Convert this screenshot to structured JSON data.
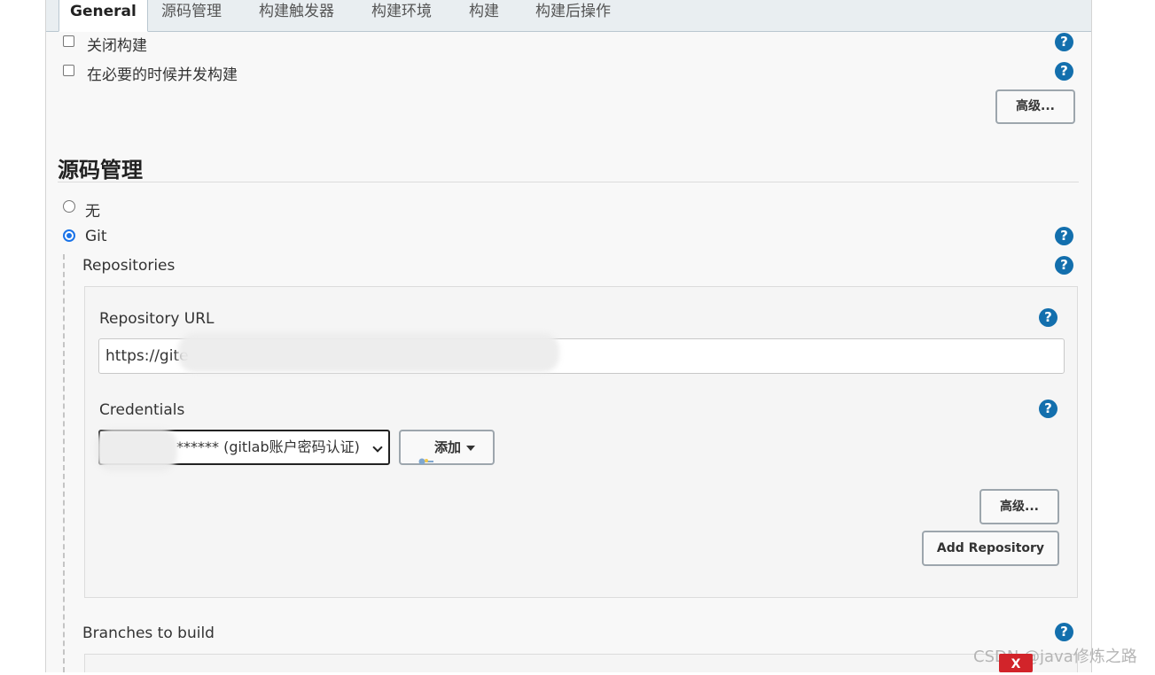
{
  "tabs": [
    "General",
    "源码管理",
    "构建触发器",
    "构建环境",
    "构建",
    "构建后操作"
  ],
  "general": {
    "disable_build": "关闭构建",
    "concurrent_build": "在必要的时候并发构建",
    "advanced": "高级..."
  },
  "scm": {
    "title": "源码管理",
    "option_none": "无",
    "option_git": "Git",
    "selected": "Git"
  },
  "git": {
    "repositories_label": "Repositories",
    "repo_url_label": "Repository URL",
    "repo_url_value": "https://gite",
    "credentials_label": "Credentials",
    "credentials_selected": "****** (gitlab账户密码认证)",
    "add_label": "添加",
    "advanced": "高级...",
    "add_repository": "Add Repository",
    "branches_label": "Branches to build"
  },
  "help_glyph": "?",
  "watermark": "CSDN @java修炼之路",
  "close_label": "X",
  "colors": {
    "help": "#136fad",
    "radio_selected": "#1a73e8",
    "close": "#d2242a"
  }
}
